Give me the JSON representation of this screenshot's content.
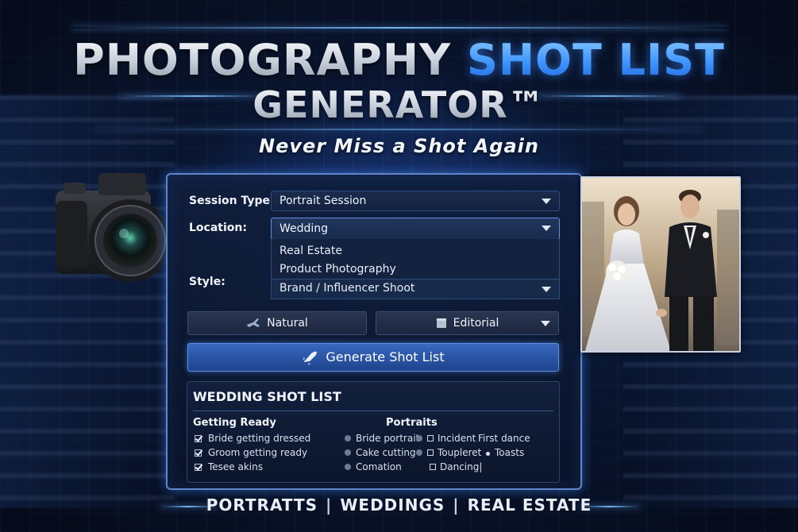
{
  "header": {
    "title_part1": "PHOTOGRAPHY",
    "title_part2": "SHOT LIST",
    "title_line2": "GENERATOR™",
    "tagline": "Never Miss a Shot Again"
  },
  "form": {
    "session_type": {
      "label": "Session Type:",
      "value": "Portrait Session"
    },
    "location": {
      "label": "Location:",
      "value": "Wedding",
      "options": [
        "Real Estate",
        "Product Photography",
        "Brand / Influencer Shoot"
      ]
    },
    "style": {
      "label": "Style:",
      "natural_label": "Natural",
      "editorial_label": "Editorial"
    },
    "generate_label": "Generate Shot List"
  },
  "shot_list": {
    "title": "WEDDING SHOT LIST",
    "getting_ready": {
      "heading": "Getting Ready",
      "items": [
        "Bride getting dressed",
        "Groom getting ready",
        "Tesee akins"
      ]
    },
    "portraits": {
      "heading": "Portraits",
      "col1": [
        "Bride portrait",
        "Cake cutting",
        "Comation"
      ],
      "col2": [
        "Incident",
        "Toupleret",
        "Dancing|"
      ],
      "col3": [
        "First dance",
        "Toasts"
      ]
    }
  },
  "footer": {
    "tags": [
      "PORTRATTS",
      "WEDDINGS",
      "REAL ESTATE"
    ],
    "separator": "|"
  },
  "colors": {
    "accent_blue": "#3e95ff",
    "panel_border": "#5f86c9",
    "background": "#0a1733"
  },
  "icons": {
    "natural": "plane-icon",
    "editorial": "document-icon",
    "generate": "rocket-icon",
    "camera": "camera-illustration"
  }
}
